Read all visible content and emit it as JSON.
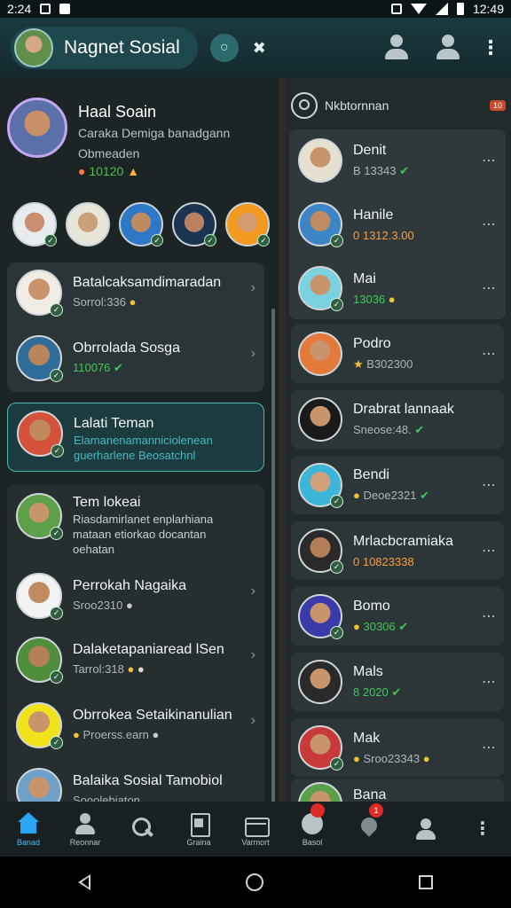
{
  "status": {
    "time_left": "2:24",
    "time_right": "12:49"
  },
  "header": {
    "title": "Nagnet Sosial",
    "chat_icon": "chat-bubble-icon",
    "close_icon": "x-icon"
  },
  "profile": {
    "name": "Haal Soain",
    "desc_line1": "Caraka Demiga banadgann",
    "desc_line2": "Obmeaden",
    "meta": "10120",
    "meta_icon": "emoji-icon"
  },
  "left_list": [
    {
      "name": "Batalcaksamdimaradan",
      "sub": "Sorrol:336",
      "sub_style": "",
      "icon": "emoji"
    },
    {
      "name": "Obrrolada Sosga",
      "sub": "110076",
      "sub_style": "green",
      "icon": "check"
    },
    {
      "name": "Lalati Teman",
      "sub": "Elamanenamanniciolenean",
      "sub2": "guerharlene Beosatchnl",
      "sub_style": "teal",
      "icon": "",
      "highlight": true
    },
    {
      "name": "Tem lokeai",
      "sub": "Riasdamirlanet enplarhiana",
      "sub2": "mataan etiorkao docantan",
      "sub3": "oehatan",
      "sub_style": "",
      "icon": ""
    },
    {
      "name": "Perrokah Nagaika",
      "sub": "Sroo2310",
      "sub_style": "",
      "icon": ""
    },
    {
      "name": "Dalaketapaniaread lSen",
      "sub": "Tarrol:318",
      "sub_style": "",
      "icon": "emoji"
    },
    {
      "name": "Obrrokea Setaikinanulian",
      "sub": "Proerss.earn",
      "sub_style": "",
      "icon": ""
    },
    {
      "name": "Balaika Sosial Tamobiol",
      "sub": "Sooolebiaton",
      "sub_style": "",
      "icon": ""
    }
  ],
  "right_header": {
    "title": "Nkbtornnan",
    "badge": "10"
  },
  "right_list": [
    {
      "name": "Denit",
      "sub": "B 13343",
      "sub_style": "",
      "icon": "check"
    },
    {
      "name": "Hanile",
      "sub": "0 1312.3.00",
      "sub_style": "orange",
      "icon": ""
    },
    {
      "name": "Mai",
      "sub": "13036",
      "sub_style": "green",
      "icon": "emoji"
    },
    {
      "name": "Podro",
      "sub": "B302300",
      "sub_style": "",
      "icon": ""
    },
    {
      "name": "Drabrat lannaak",
      "sub": "Sneose:48.",
      "sub_style": "",
      "icon": "check"
    },
    {
      "name": "Bendi",
      "sub": "Deoe2321",
      "sub_style": "",
      "icon": "check"
    },
    {
      "name": "Mrlacbcramiaka",
      "sub": "0 10823338",
      "sub_style": "orange",
      "icon": ""
    },
    {
      "name": "Bomo",
      "sub": "30306",
      "sub_style": "green",
      "icon": "check"
    },
    {
      "name": "Mals",
      "sub": "8 2020",
      "sub_style": "green",
      "icon": "check"
    },
    {
      "name": "Mak",
      "sub": "Sroo23343",
      "sub_style": "",
      "icon": "emoji"
    },
    {
      "name": "Bana",
      "sub": "",
      "sub_style": "",
      "icon": ""
    }
  ],
  "bottom_nav": [
    {
      "label": "Banad",
      "icon": "home"
    },
    {
      "label": "Reonnar",
      "icon": "person"
    },
    {
      "label": "",
      "icon": "search"
    },
    {
      "label": "Graina",
      "icon": "doc"
    },
    {
      "label": "Varmort",
      "icon": "bag"
    },
    {
      "label": "Basol",
      "icon": "clock",
      "badge": ""
    },
    {
      "label": "",
      "icon": "pin",
      "badge": "1"
    },
    {
      "label": "",
      "icon": "person"
    },
    {
      "label": "",
      "icon": "dots"
    }
  ],
  "colors": {
    "accent": "#2aa4f4",
    "green": "#3fc85a",
    "teal": "#4ab7c0",
    "orange": "#ff9d3a"
  }
}
